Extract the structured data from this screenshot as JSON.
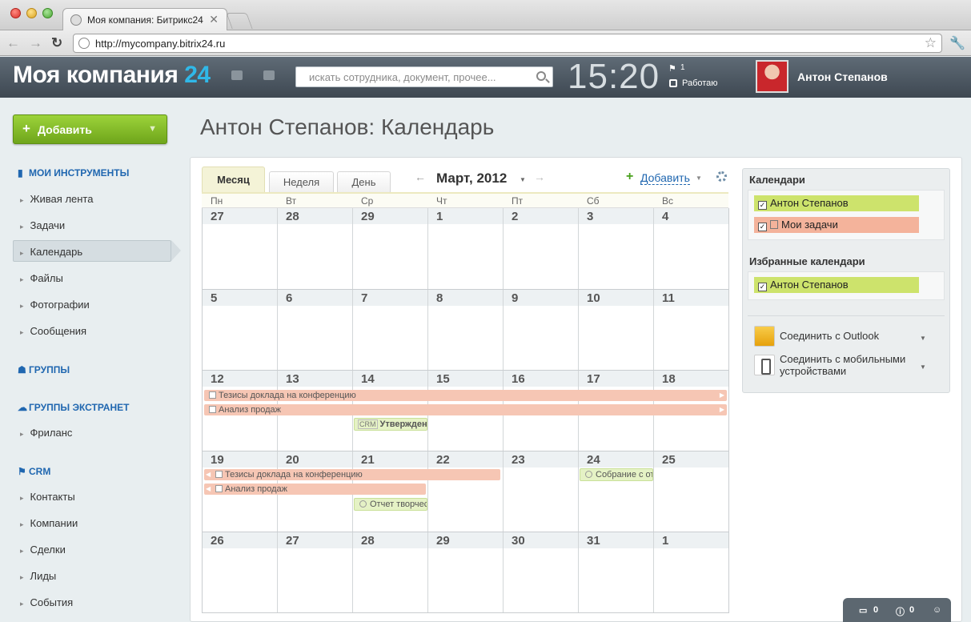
{
  "browser": {
    "tab_title": "Моя компания: Битрикс24",
    "tab_close": "✕",
    "url": "http://mycompany.bitrix24.ru"
  },
  "header": {
    "logo_text": "Моя компания",
    "logo_number": "24",
    "search_placeholder": "искать сотрудника, документ, прочее...",
    "clock": "15:20",
    "flag_count": "1",
    "status": "Работаю",
    "user_name": "Антон Степанов"
  },
  "sidebar": {
    "add_button": "Добавить",
    "sections": {
      "tools": "МОИ ИНСТРУМЕНТЫ",
      "groups": "ГРУППЫ",
      "extranet": "ГРУППЫ ЭКСТРАНЕТ",
      "crm": "CRM"
    },
    "tools_items": [
      "Живая лента",
      "Задачи",
      "Календарь",
      "Файлы",
      "Фотографии",
      "Сообщения"
    ],
    "extranet_items": [
      "Фриланс"
    ],
    "crm_items": [
      "Контакты",
      "Компании",
      "Сделки",
      "Лиды",
      "События"
    ]
  },
  "page": {
    "title": "Антон Степанов: Календарь"
  },
  "calendar": {
    "tabs": [
      "Месяц",
      "Неделя",
      "День"
    ],
    "active_tab": "Месяц",
    "month_title": "Март, 2012",
    "add_label": "Добавить",
    "weekdays": [
      "Пн",
      "Вт",
      "Ср",
      "Чт",
      "Пт",
      "Сб",
      "Вс"
    ],
    "weeks": [
      [
        "27",
        "28",
        "29",
        "1",
        "2",
        "3",
        "4"
      ],
      [
        "5",
        "6",
        "7",
        "8",
        "9",
        "10",
        "11"
      ],
      [
        "12",
        "13",
        "14",
        "15",
        "16",
        "17",
        "18"
      ],
      [
        "19",
        "20",
        "21",
        "22",
        "23",
        "24",
        "25"
      ],
      [
        "26",
        "27",
        "28",
        "29",
        "30",
        "31",
        "1"
      ]
    ],
    "events": {
      "thesis": "Тезисы доклада на конференцию",
      "sales": "Анализ продаж",
      "crm_tag": "CRM",
      "approval": "Утверждени",
      "report": "Отчет творчес",
      "meeting": "Собрание с от"
    }
  },
  "right_panel": {
    "calendars_title": "Календари",
    "calendars": [
      "Антон Степанов",
      "Мои задачи"
    ],
    "favorites_title": "Избранные календари",
    "favorites": [
      "Антон Степанов"
    ],
    "outlook_link": "Соединить с Outlook",
    "mobile_link_1": "Соединить с мобильными",
    "mobile_link_2": "устройствами"
  },
  "bottom_widget": {
    "messages_count": "0",
    "notifications_count": "0"
  },
  "colors": {
    "accent_blue": "#2067b0",
    "logo_number": "#30b8e8",
    "add_button_green": "#7ab52a",
    "calendar_green": "#cde36c",
    "task_red": "#f4b39b"
  }
}
